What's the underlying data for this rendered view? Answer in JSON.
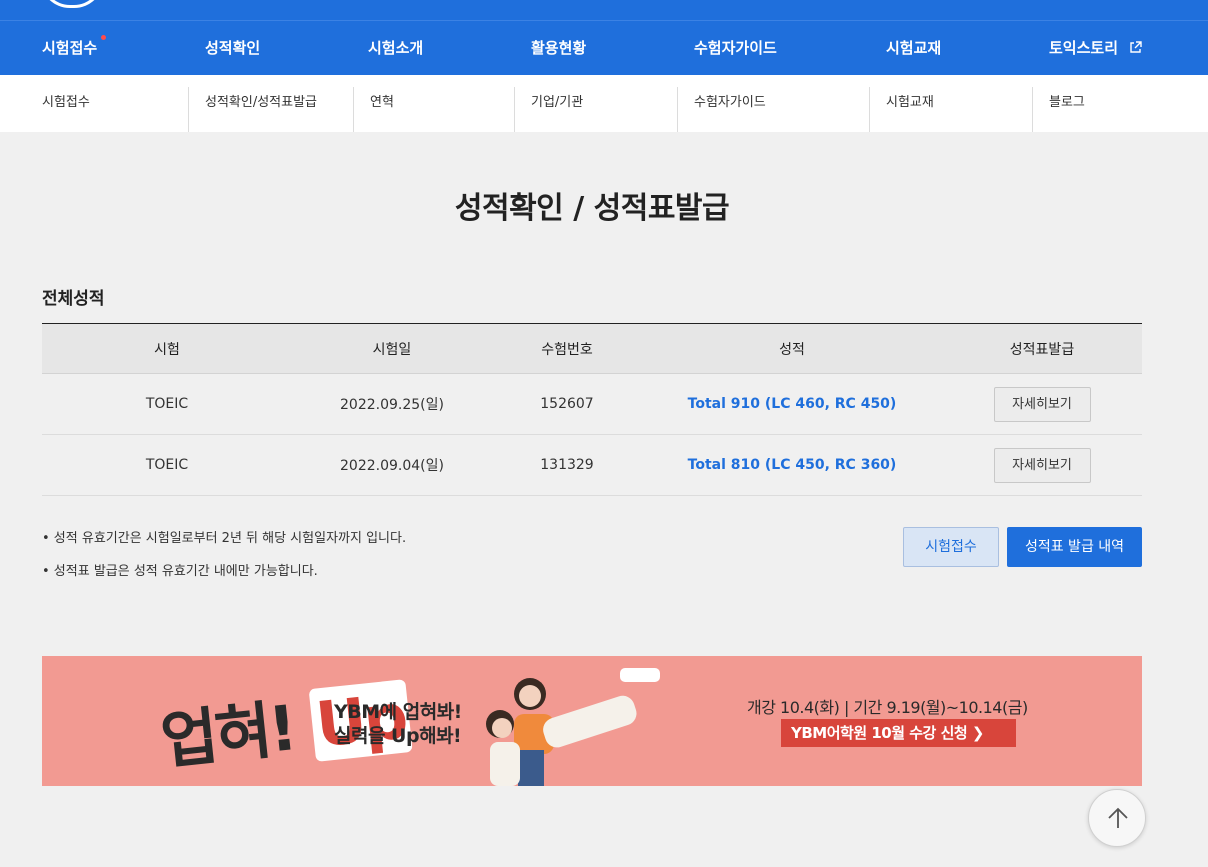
{
  "nav": {
    "items": [
      {
        "label": "시험접수",
        "has_dot": true
      },
      {
        "label": "성적확인"
      },
      {
        "label": "시험소개"
      },
      {
        "label": "활용현황"
      },
      {
        "label": "수험자가이드"
      },
      {
        "label": "시험교재"
      },
      {
        "label": "토익스토리",
        "external": true
      }
    ]
  },
  "submenu": {
    "col1": "시험접수",
    "col2": "성적확인/성적표발급",
    "col3": "연혁",
    "col4": "기업/기관",
    "col5": "수험자가이드",
    "col6": "시험교재",
    "col7": "블로그"
  },
  "page": {
    "title": "성적확인 / 성적표발급",
    "section": "전체성적"
  },
  "table": {
    "headers": [
      "시험",
      "시험일",
      "수험번호",
      "성적",
      "성적표발급"
    ],
    "rows": [
      {
        "test": "TOEIC",
        "date": "2022.09.25(일)",
        "number": "152607",
        "score": "Total 910 (LC 460, RC 450)",
        "button": "자세히보기"
      },
      {
        "test": "TOEIC",
        "date": "2022.09.04(일)",
        "number": "131329",
        "score": "Total 810 (LC 450, RC 360)",
        "button": "자세히보기"
      }
    ]
  },
  "notes": [
    "• 성적 유효기간은 시험일로부터 2년 뒤 해당 시험일자까지 입니다.",
    "• 성적표 발급은 성적 유효기간 내에만 가능합니다."
  ],
  "actions": {
    "apply": "시험접수",
    "history": "성적표 발급 내역"
  },
  "banner": {
    "logo": "업혀!",
    "logo_up": "Up",
    "slogan_line1": "YBM에 업혀봐!",
    "slogan_line2": "실력을 Up해봐!",
    "info": "개강 10.4(화) | 기간 9.19(월)~10.14(금)",
    "cta": "YBM어학원 10월 수강 신청 ❯",
    "bg_color": "#f29a92",
    "accent_color": "#d8453b"
  },
  "colors": {
    "primary": "#1f6fdc",
    "background": "#f0f0f0"
  }
}
